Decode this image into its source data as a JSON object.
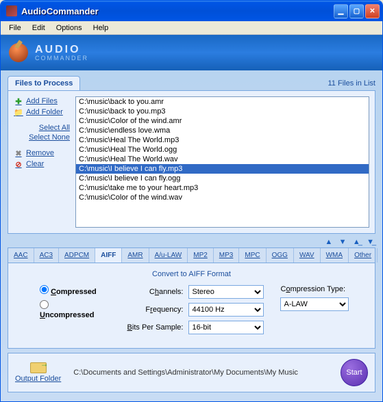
{
  "window": {
    "title": "AudioCommander"
  },
  "menu": {
    "file": "File",
    "edit": "Edit",
    "options": "Options",
    "help": "Help"
  },
  "brand": {
    "line1": "AUDIO",
    "line2": "COMMANDER"
  },
  "filesTab": "Files to Process",
  "filesCount": "11 Files in List",
  "side": {
    "addFiles": "Add Files",
    "addFolder": "Add Folder",
    "selectAll": "Select All",
    "selectNone": "Select None",
    "remove": "Remove",
    "clear": "Clear"
  },
  "files": [
    "C:\\music\\back to you.amr",
    "C:\\music\\back to you.mp3",
    "C:\\music\\Color of the wind.amr",
    "C:\\music\\endless love.wma",
    "C:\\music\\Heal The World.mp3",
    "C:\\music\\Heal The World.ogg",
    "C:\\music\\Heal The World.wav",
    "C:\\music\\I believe I can fly.mp3",
    "C:\\music\\I believe I can fly.ogg",
    "C:\\music\\take me to your heart.mp3",
    "C:\\music\\Color of the wind.wav"
  ],
  "selectedIndex": 7,
  "formats": [
    "AAC",
    "AC3",
    "ADPCM",
    "AIFF",
    "AMR",
    "A/u-LAW",
    "MP2",
    "MP3",
    "MPC",
    "OGG",
    "WAV",
    "WMA",
    "Other"
  ],
  "activeFormat": "AIFF",
  "conv": {
    "title": "Convert to AIFF Format",
    "compressed": "Compressed",
    "uncompressed": "Uncompressed",
    "compressedChecked": true,
    "channelsLabel": "Channels:",
    "channels": "Stereo",
    "freqLabel": "Frequency:",
    "freq": "44100 Hz",
    "bpsLabel": "Bits Per Sample:",
    "bps": "16-bit",
    "ctypeLabel": "Compression Type:",
    "ctype": "A-LAW"
  },
  "footer": {
    "outputFolderLabel": "Output Folder",
    "outputPath": "C:\\Documents and Settings\\Administrator\\My Documents\\My Music",
    "start": "Start"
  }
}
